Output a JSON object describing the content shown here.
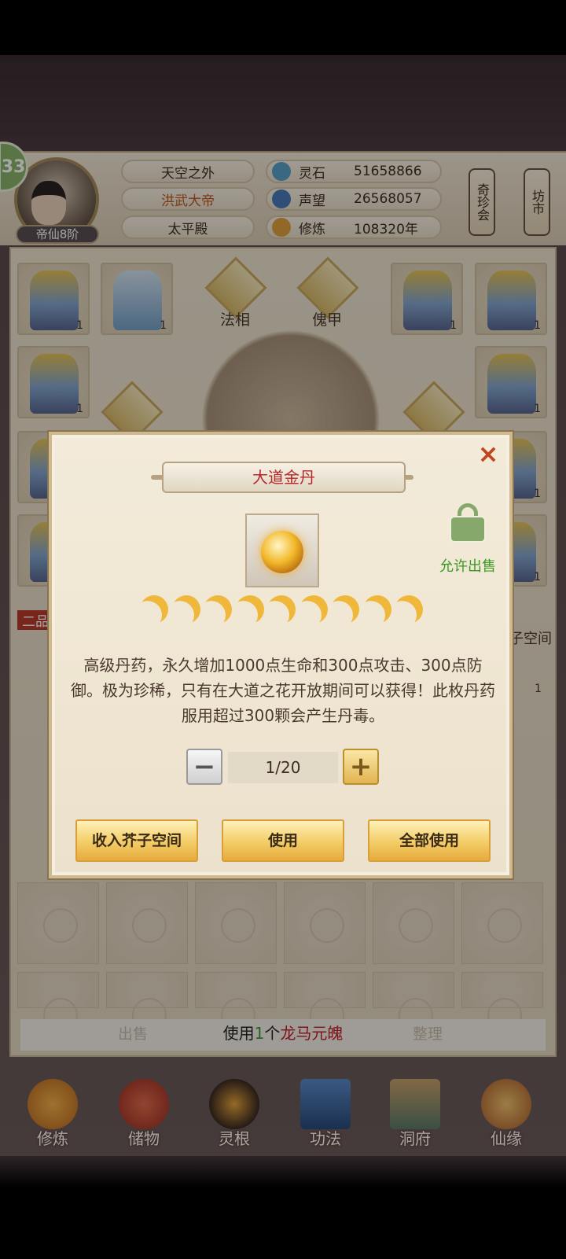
{
  "player": {
    "level": "33",
    "rank": "帝仙8阶"
  },
  "info": {
    "realm": "天空之外",
    "title": "洪武大帝",
    "palace": "太平殿",
    "stats": [
      {
        "label": "灵石",
        "value": "51658866"
      },
      {
        "label": "声望",
        "value": "26568057"
      },
      {
        "label": "修炼",
        "value": "108320年"
      }
    ]
  },
  "side_buttons": [
    "奇珍会",
    "坊市"
  ],
  "equipment": {
    "slot_labels": [
      "法相",
      "傀甲"
    ],
    "counts": [
      "1",
      "1",
      "1",
      "1",
      "1",
      "1",
      "1",
      "1",
      "1",
      "1"
    ],
    "behind_labels": {
      "tab": "二品",
      "space": "子空间"
    }
  },
  "bottom_strip": {
    "sell": "出售",
    "sort": "整理",
    "message_prefix": "使用",
    "message_count": "1",
    "message_unit": "个",
    "message_item": "龙马元魄"
  },
  "nav": [
    "修炼",
    "储物",
    "灵根",
    "功法",
    "洞府",
    "仙缘"
  ],
  "modal": {
    "title": "大道金丹",
    "close": "×",
    "sale_label": "允许出售",
    "star_count": 9,
    "description": "高级丹药，永久增加1000点生命和300点攻击、300点防御。极为珍稀，只有在大道之花开放期间可以获得！此枚丹药服用超过300颗会产生丹毒。",
    "quantity": "1/20",
    "minus": "−",
    "plus": "+",
    "buttons": {
      "store": "收入芥子空间",
      "use": "使用",
      "use_all": "全部使用"
    }
  }
}
